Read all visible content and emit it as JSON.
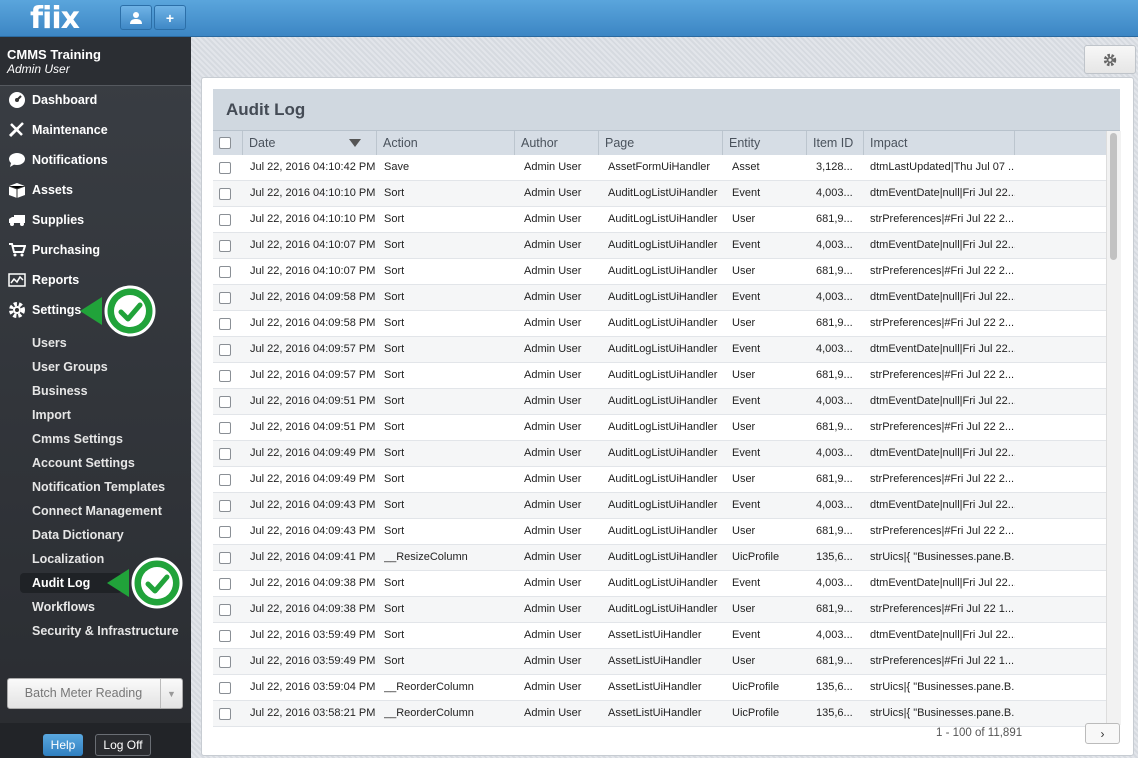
{
  "app": {
    "logo": "fiix"
  },
  "topbar": {
    "user_icon": "user-icon",
    "add_icon": "plus-icon"
  },
  "sidebar": {
    "company": "CMMS Training",
    "user": "Admin User",
    "nav": [
      {
        "label": "Dashboard",
        "icon": "dashboard-icon"
      },
      {
        "label": "Maintenance",
        "icon": "wrench-icon"
      },
      {
        "label": "Notifications",
        "icon": "chat-bubble-icon"
      },
      {
        "label": "Assets",
        "icon": "boxes-icon"
      },
      {
        "label": "Supplies",
        "icon": "truck-icon"
      },
      {
        "label": "Purchasing",
        "icon": "cart-icon"
      },
      {
        "label": "Reports",
        "icon": "chart-icon"
      },
      {
        "label": "Settings",
        "icon": "gear-icon"
      }
    ],
    "settings_items": [
      "Users",
      "User Groups",
      "Business",
      "Import",
      "Cmms Settings",
      "Account Settings",
      "Notification Templates",
      "Connect Management",
      "Data Dictionary",
      "Localization",
      "Audit Log",
      "Workflows",
      "Security & Infrastructure"
    ],
    "active_item": "Audit Log",
    "batch_label": "Batch Meter Reading",
    "help_label": "Help",
    "logoff_label": "Log Off"
  },
  "panel": {
    "title": "Audit Log",
    "columns": [
      "Date",
      "Action",
      "Author",
      "Page",
      "Entity",
      "Item ID",
      "Impact"
    ],
    "rows": [
      [
        "Jul 22, 2016 04:10:42 PM",
        "Save",
        "Admin User",
        "AssetFormUiHandler",
        "Asset",
        "3,128...",
        "dtmLastUpdated|Thu Jul 07 ..."
      ],
      [
        "Jul 22, 2016 04:10:10 PM",
        "Sort",
        "Admin User",
        "AuditLogListUiHandler",
        "Event",
        "4,003...",
        "dtmEventDate|null|Fri Jul 22..."
      ],
      [
        "Jul 22, 2016 04:10:10 PM",
        "Sort",
        "Admin User",
        "AuditLogListUiHandler",
        "User",
        "681,9...",
        "strPreferences|#Fri Jul 22 2..."
      ],
      [
        "Jul 22, 2016 04:10:07 PM",
        "Sort",
        "Admin User",
        "AuditLogListUiHandler",
        "Event",
        "4,003...",
        "dtmEventDate|null|Fri Jul 22..."
      ],
      [
        "Jul 22, 2016 04:10:07 PM",
        "Sort",
        "Admin User",
        "AuditLogListUiHandler",
        "User",
        "681,9...",
        "strPreferences|#Fri Jul 22 2..."
      ],
      [
        "Jul 22, 2016 04:09:58 PM",
        "Sort",
        "Admin User",
        "AuditLogListUiHandler",
        "Event",
        "4,003...",
        "dtmEventDate|null|Fri Jul 22..."
      ],
      [
        "Jul 22, 2016 04:09:58 PM",
        "Sort",
        "Admin User",
        "AuditLogListUiHandler",
        "User",
        "681,9...",
        "strPreferences|#Fri Jul 22 2..."
      ],
      [
        "Jul 22, 2016 04:09:57 PM",
        "Sort",
        "Admin User",
        "AuditLogListUiHandler",
        "Event",
        "4,003...",
        "dtmEventDate|null|Fri Jul 22..."
      ],
      [
        "Jul 22, 2016 04:09:57 PM",
        "Sort",
        "Admin User",
        "AuditLogListUiHandler",
        "User",
        "681,9...",
        "strPreferences|#Fri Jul 22 2..."
      ],
      [
        "Jul 22, 2016 04:09:51 PM",
        "Sort",
        "Admin User",
        "AuditLogListUiHandler",
        "Event",
        "4,003...",
        "dtmEventDate|null|Fri Jul 22..."
      ],
      [
        "Jul 22, 2016 04:09:51 PM",
        "Sort",
        "Admin User",
        "AuditLogListUiHandler",
        "User",
        "681,9...",
        "strPreferences|#Fri Jul 22 2..."
      ],
      [
        "Jul 22, 2016 04:09:49 PM",
        "Sort",
        "Admin User",
        "AuditLogListUiHandler",
        "Event",
        "4,003...",
        "dtmEventDate|null|Fri Jul 22..."
      ],
      [
        "Jul 22, 2016 04:09:49 PM",
        "Sort",
        "Admin User",
        "AuditLogListUiHandler",
        "User",
        "681,9...",
        "strPreferences|#Fri Jul 22 2..."
      ],
      [
        "Jul 22, 2016 04:09:43 PM",
        "Sort",
        "Admin User",
        "AuditLogListUiHandler",
        "Event",
        "4,003...",
        "dtmEventDate|null|Fri Jul 22..."
      ],
      [
        "Jul 22, 2016 04:09:43 PM",
        "Sort",
        "Admin User",
        "AuditLogListUiHandler",
        "User",
        "681,9...",
        "strPreferences|#Fri Jul 22 2..."
      ],
      [
        "Jul 22, 2016 04:09:41 PM",
        "__ResizeColumn",
        "Admin User",
        "AuditLogListUiHandler",
        "UicProfile",
        "135,6...",
        "strUics|{ \"Businesses.pane.B..."
      ],
      [
        "Jul 22, 2016 04:09:38 PM",
        "Sort",
        "Admin User",
        "AuditLogListUiHandler",
        "Event",
        "4,003...",
        "dtmEventDate|null|Fri Jul 22..."
      ],
      [
        "Jul 22, 2016 04:09:38 PM",
        "Sort",
        "Admin User",
        "AuditLogListUiHandler",
        "User",
        "681,9...",
        "strPreferences|#Fri Jul 22 1..."
      ],
      [
        "Jul 22, 2016 03:59:49 PM",
        "Sort",
        "Admin User",
        "AssetListUiHandler",
        "Event",
        "4,003...",
        "dtmEventDate|null|Fri Jul 22..."
      ],
      [
        "Jul 22, 2016 03:59:49 PM",
        "Sort",
        "Admin User",
        "AssetListUiHandler",
        "User",
        "681,9...",
        "strPreferences|#Fri Jul 22 1..."
      ],
      [
        "Jul 22, 2016 03:59:04 PM",
        "__ReorderColumn",
        "Admin User",
        "AssetListUiHandler",
        "UicProfile",
        "135,6...",
        "strUics|{ \"Businesses.pane.B..."
      ],
      [
        "Jul 22, 2016 03:58:21 PM",
        "__ReorderColumn",
        "Admin User",
        "AssetListUiHandler",
        "UicProfile",
        "135,6...",
        "strUics|{ \"Businesses.pane.B..."
      ]
    ],
    "pager_text": "1 - 100 of 11,891",
    "next_label": "›"
  },
  "colors": {
    "topbar": "#4a96d2",
    "sidebar": "#33363b",
    "check_green": "#21a33a",
    "accent_blue": "#3a86c6"
  }
}
